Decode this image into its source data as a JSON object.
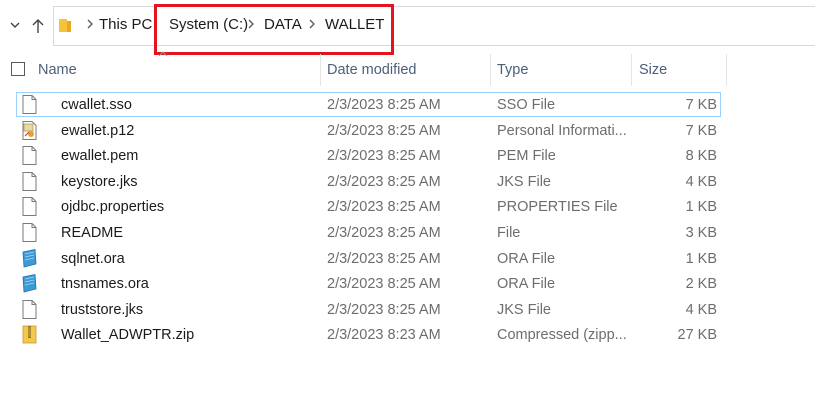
{
  "breadcrumb": {
    "items": [
      "This PC",
      "System (C:)",
      "DATA",
      "WALLET"
    ]
  },
  "columns": {
    "name": "Name",
    "date": "Date modified",
    "type": "Type",
    "size": "Size"
  },
  "files": [
    {
      "name": "cwallet.sso",
      "date": "2/3/2023 8:25 AM",
      "type": "SSO File",
      "size": "7 KB",
      "icon": "document-icon"
    },
    {
      "name": "ewallet.p12",
      "date": "2/3/2023 8:25 AM",
      "type": "Personal Informati...",
      "size": "7 KB",
      "icon": "certificate-icon"
    },
    {
      "name": "ewallet.pem",
      "date": "2/3/2023 8:25 AM",
      "type": "PEM File",
      "size": "8 KB",
      "icon": "document-icon"
    },
    {
      "name": "keystore.jks",
      "date": "2/3/2023 8:25 AM",
      "type": "JKS File",
      "size": "4 KB",
      "icon": "document-icon"
    },
    {
      "name": "ojdbc.properties",
      "date": "2/3/2023 8:25 AM",
      "type": "PROPERTIES File",
      "size": "1 KB",
      "icon": "document-icon"
    },
    {
      "name": "README",
      "date": "2/3/2023 8:25 AM",
      "type": "File",
      "size": "3 KB",
      "icon": "document-icon"
    },
    {
      "name": "sqlnet.ora",
      "date": "2/3/2023 8:25 AM",
      "type": "ORA File",
      "size": "1 KB",
      "icon": "ora-file-icon"
    },
    {
      "name": "tnsnames.ora",
      "date": "2/3/2023 8:25 AM",
      "type": "ORA File",
      "size": "2 KB",
      "icon": "ora-file-icon"
    },
    {
      "name": "truststore.jks",
      "date": "2/3/2023 8:25 AM",
      "type": "JKS File",
      "size": "4 KB",
      "icon": "document-icon"
    },
    {
      "name": "Wallet_ADWPTR.zip",
      "date": "2/3/2023 8:23 AM",
      "type": "Compressed (zipp...",
      "size": "27 KB",
      "icon": "zip-folder-icon"
    }
  ],
  "colors": {
    "highlight": "#e3141e",
    "selection_border": "#99d1ff",
    "header_text": "#4c607a"
  }
}
